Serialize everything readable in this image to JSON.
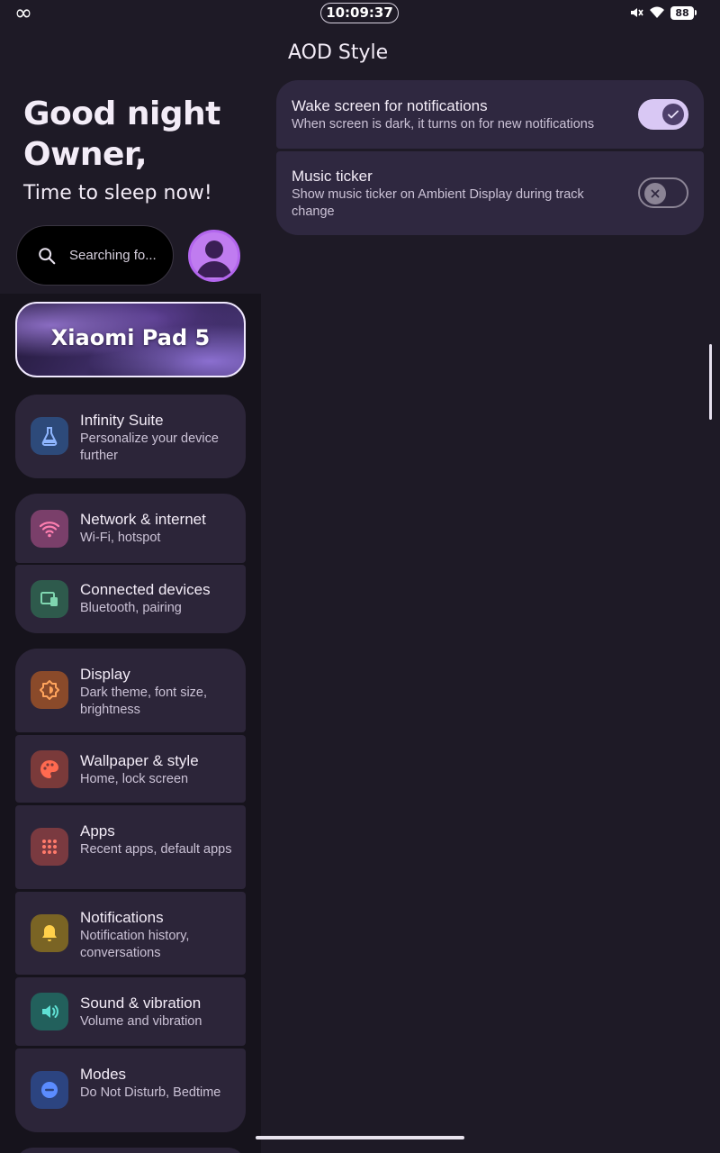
{
  "status_bar": {
    "logo": "∞",
    "time": "10:09:37",
    "battery": "88"
  },
  "greeting": {
    "line1": "Good night",
    "line2": "Owner,",
    "subtitle": "Time to sleep now!"
  },
  "search": {
    "placeholder": "Searching fo..."
  },
  "device": {
    "name": "Xiaomi Pad 5"
  },
  "menu": [
    {
      "title": "Infinity Suite",
      "subtitle": "Personalize your device further",
      "icon": "flask-icon",
      "color": "#2d4a7a"
    },
    {
      "title": "Network & internet",
      "subtitle": "Wi-Fi, hotspot",
      "icon": "wifi-icon",
      "color": "#7a3f6a"
    },
    {
      "title": "Connected devices",
      "subtitle": "Bluetooth, pairing",
      "icon": "devices-icon",
      "color": "#2e5a4c"
    },
    {
      "title": "Display",
      "subtitle": "Dark theme, font size, brightness",
      "icon": "brightness-icon",
      "color": "#8a4a2a"
    },
    {
      "title": "Wallpaper & style",
      "subtitle": "Home, lock screen",
      "icon": "palette-icon",
      "color": "#7a3a3a"
    },
    {
      "title": "Apps",
      "subtitle": "Recent apps, default apps",
      "icon": "apps-grid-icon",
      "color": "#7a3a40"
    },
    {
      "title": "Notifications",
      "subtitle": "Notification history, conversations",
      "icon": "bell-icon",
      "color": "#7a6424"
    },
    {
      "title": "Sound & vibration",
      "subtitle": "Volume and vibration",
      "icon": "speaker-icon",
      "color": "#22605c"
    },
    {
      "title": "Modes",
      "subtitle": "Do Not Disturb, Bedtime",
      "icon": "dnd-icon",
      "color": "#2c4480"
    }
  ],
  "detail": {
    "title": "AOD Style",
    "prefs": [
      {
        "title": "Wake screen for notifications",
        "subtitle": "When screen is dark, it turns on for new notifications",
        "enabled": true
      },
      {
        "title": "Music ticker",
        "subtitle": "Show music ticker on Ambient Display during track change",
        "enabled": false
      }
    ]
  },
  "colors": {
    "background": "#1e1a26",
    "card": "#2c2539",
    "accent": "#d9c8f4"
  }
}
